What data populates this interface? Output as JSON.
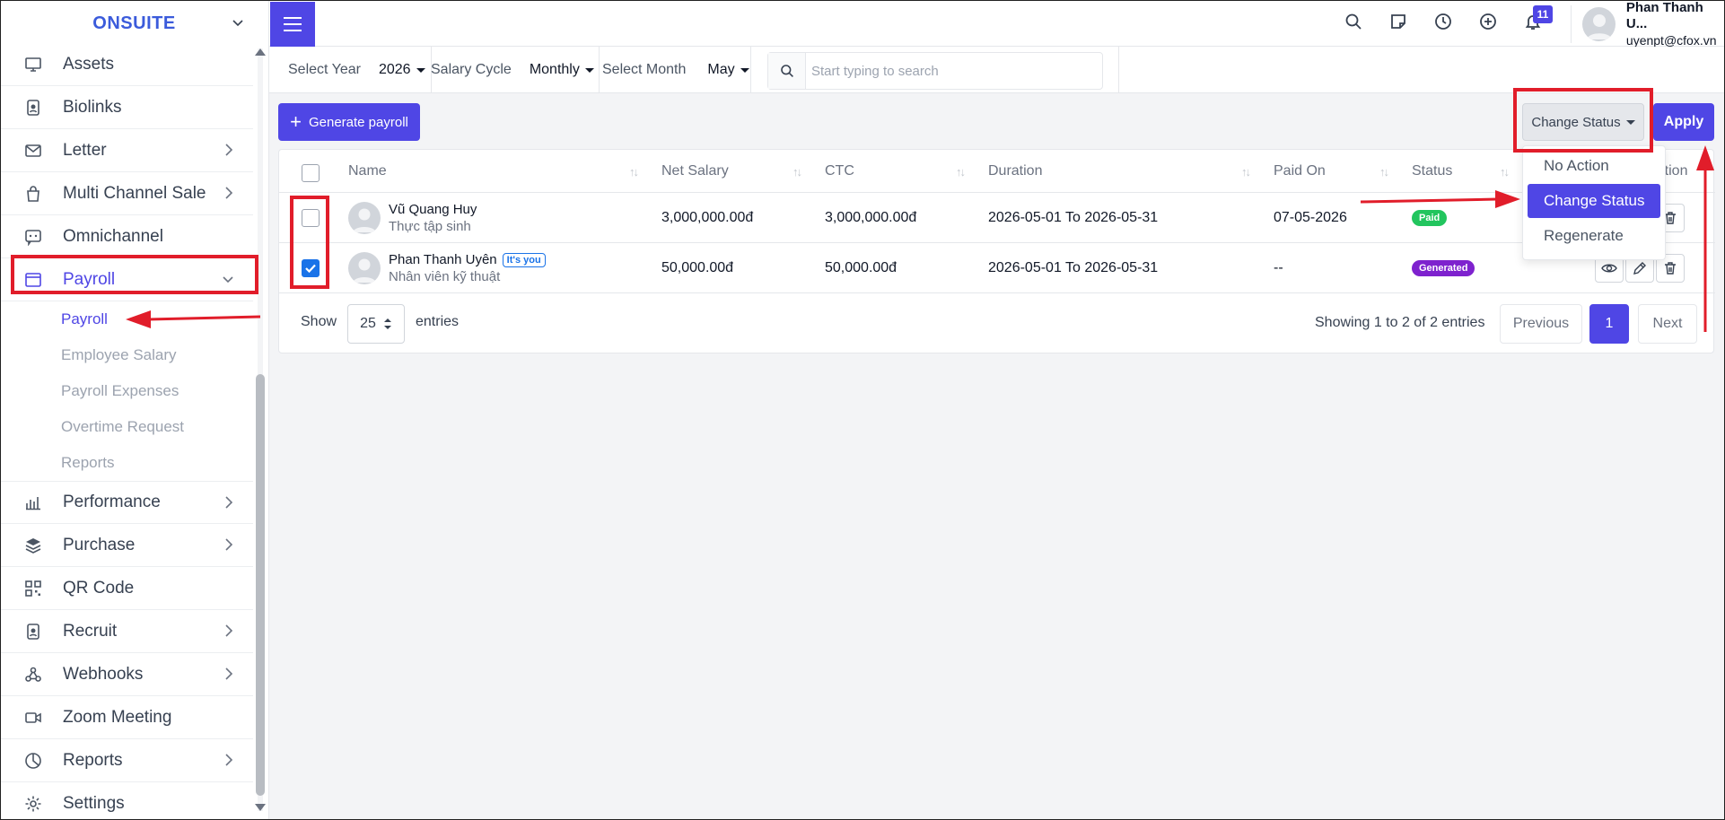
{
  "brand": {
    "name": "ONSUITE"
  },
  "sidebar": {
    "items": [
      {
        "label": "Assets",
        "icon": "monitor-icon",
        "arrow": false
      },
      {
        "label": "Biolinks",
        "icon": "id-badge-icon",
        "arrow": false
      },
      {
        "label": "Letter",
        "icon": "envelope-icon",
        "arrow": true
      },
      {
        "label": "Multi Channel Sale",
        "icon": "shopping-bag-icon",
        "arrow": true
      },
      {
        "label": "Omnichannel",
        "icon": "chat-icon",
        "arrow": false
      },
      {
        "label": "Payroll",
        "icon": "window-icon",
        "arrow": true,
        "active": true
      }
    ],
    "payroll_sub": [
      "Payroll",
      "Employee Salary",
      "Payroll Expenses",
      "Overtime Request",
      "Reports"
    ],
    "items_after": [
      {
        "label": "Performance",
        "icon": "bar-chart-icon",
        "arrow": true
      },
      {
        "label": "Purchase",
        "icon": "layers-icon",
        "arrow": true
      },
      {
        "label": "QR Code",
        "icon": "qr-code-icon",
        "arrow": false
      },
      {
        "label": "Recruit",
        "icon": "id-badge-icon",
        "arrow": true
      },
      {
        "label": "Webhooks",
        "icon": "webhook-icon",
        "arrow": true
      },
      {
        "label": "Zoom Meeting",
        "icon": "video-icon",
        "arrow": false
      },
      {
        "label": "Reports",
        "icon": "pie-chart-icon",
        "arrow": true
      },
      {
        "label": "Settings",
        "icon": "gear-icon",
        "arrow": false
      }
    ]
  },
  "topbar": {
    "notification_count": "11",
    "user_name": "Phan Thanh U...",
    "user_email": "uyenpt@cfox.vn"
  },
  "filters": {
    "year_label": "Select Year",
    "year_value": "2026",
    "cycle_label": "Salary Cycle",
    "cycle_value": "Monthly",
    "month_label": "Select Month",
    "month_value": "May",
    "search_placeholder": "Start typing to search"
  },
  "actions": {
    "generate_label": "Generate payroll",
    "change_status_label": "Change Status",
    "apply_label": "Apply"
  },
  "dropdown": {
    "options": [
      "No Action",
      "Change Status",
      "Regenerate"
    ],
    "selected": "Change Status"
  },
  "table": {
    "headers": [
      "Name",
      "Net Salary",
      "CTC",
      "Duration",
      "Paid On",
      "Status",
      "Action"
    ],
    "rows": [
      {
        "checked": false,
        "name": "Vũ Quang Huy",
        "role": "Thực tập sinh",
        "you": "",
        "net_salary": "3,000,000.00đ",
        "ctc": "3,000,000.00đ",
        "duration": "2026-05-01 To 2026-05-31",
        "paid_on": "07-05-2026",
        "status": "Paid"
      },
      {
        "checked": true,
        "name": "Phan Thanh Uyên",
        "role": "Nhân viên kỹ thuật",
        "you": "It's you",
        "net_salary": "50,000.00đ",
        "ctc": "50,000.00đ",
        "duration": "2026-05-01 To 2026-05-31",
        "paid_on": "--",
        "status": "Generated"
      }
    ]
  },
  "pagination": {
    "show_label": "Show",
    "entries_label": "entries",
    "page_length": "25",
    "info": "Showing 1 to 2 of 2 entries",
    "previous": "Previous",
    "current": "1",
    "next": "Next"
  },
  "colors": {
    "accent": "#4f46e5",
    "paid": "#22c55e",
    "generated": "#7e22ce",
    "annotation": "#e11d2a"
  }
}
